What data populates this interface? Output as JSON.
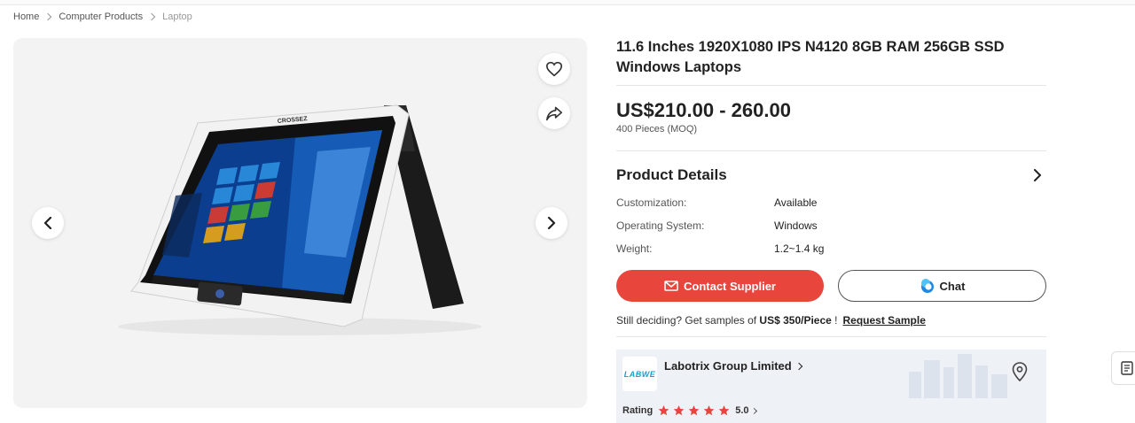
{
  "breadcrumb": {
    "items": [
      "Home",
      "Computer Products",
      "Laptop"
    ]
  },
  "gallery": {
    "favorite_icon": "heart-icon",
    "share_icon": "share-icon",
    "prev_icon": "chevron-left-icon",
    "next_icon": "chevron-right-icon",
    "laptop_brand": "CROSSEZ"
  },
  "product": {
    "title": "11.6 Inches 1920X1080 IPS N4120 8GB RAM 256GB SSD Windows Laptops",
    "price": "US$210.00 - 260.00",
    "moq": "400 Pieces (MOQ)"
  },
  "details": {
    "heading": "Product Details",
    "attributes": [
      {
        "key": "Customization:",
        "value": "Available"
      },
      {
        "key": "Operating System:",
        "value": "Windows"
      },
      {
        "key": "Weight:",
        "value": "1.2~1.4 kg"
      }
    ]
  },
  "actions": {
    "contact_label": "Contact Supplier",
    "chat_label": "Chat"
  },
  "samples": {
    "prefix": "Still deciding? Get samples of ",
    "price": "US$ 350/Piece",
    "suffix": " !",
    "link": "Request Sample"
  },
  "supplier": {
    "logo_text": "LABWE",
    "name": "Labotrix Group Limited",
    "rating_label": "Rating",
    "rating": 5.0,
    "rating_text": "5.0",
    "stars": 5
  },
  "colors": {
    "accent": "#e8453c",
    "star": "#e8453c",
    "logo": "#1aa0c9"
  }
}
